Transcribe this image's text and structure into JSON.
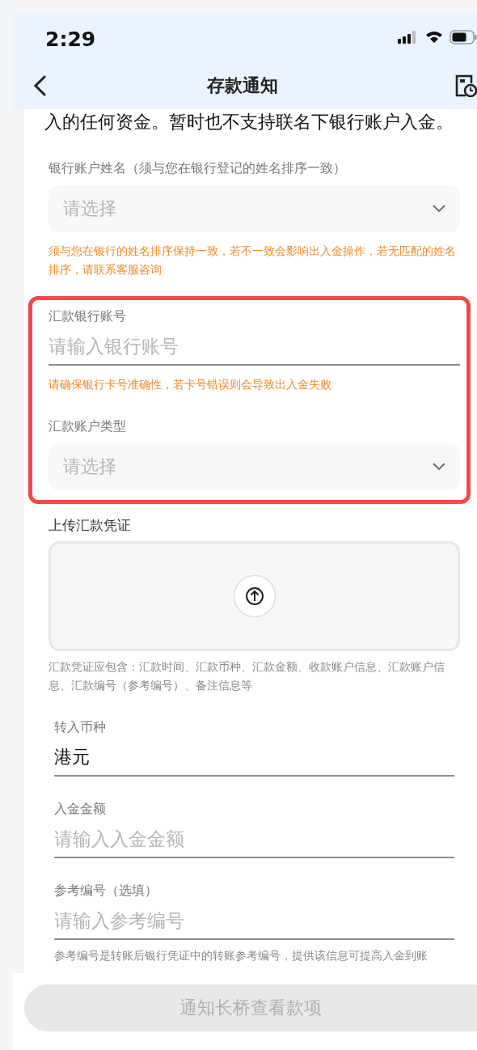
{
  "status_bar": {
    "time": "2:29"
  },
  "nav": {
    "title": "存款通知"
  },
  "intro": "入的任何资金。暂时也不支持联名下银行账户入金。",
  "sections": [
    {
      "kind": "plain",
      "fields": [
        {
          "kind": "select",
          "label": "银行账户姓名（须与您在银行登记的姓名排序一致）",
          "placeholder": "请选择",
          "hint": {
            "kind": "warning",
            "text": "须与您在银行的姓名排序保持一致，若不一致会影响出入金操作，若无匹配的姓名排序，请联系客服咨询"
          }
        }
      ]
    },
    {
      "kind": "highlighted",
      "fields": [
        {
          "kind": "input",
          "label": "汇款银行账号",
          "placeholder": "请输入银行账号",
          "hint": {
            "kind": "warning",
            "text": "请确保银行卡号准确性，若卡号错误则会导致出入金失败"
          }
        },
        {
          "kind": "select",
          "label": "汇款账户类型",
          "placeholder": "请选择"
        }
      ]
    },
    {
      "kind": "plain",
      "fields": [
        {
          "kind": "upload",
          "label": "上传汇款凭证",
          "hint": {
            "kind": "note",
            "text": "汇款凭证应包含：汇款时间、汇款币种、汇款金额、收款账户信息、汇款账户信息、汇款编号（参考编号）、备注信息等"
          }
        },
        {
          "kind": "input",
          "label": "转入币种",
          "value": "港元"
        },
        {
          "kind": "input",
          "label": "入金金额",
          "placeholder": "请输入入金金额"
        },
        {
          "kind": "input",
          "label": "参考编号（选填）",
          "placeholder": "请输入参考编号",
          "hint": {
            "kind": "note",
            "text": "参考编号是转账后银行凭证中的转账参考编号，提供该信息可提高入金到账"
          }
        }
      ]
    }
  ],
  "submit": {
    "label": "通知长桥查看款项",
    "disabled": true
  }
}
